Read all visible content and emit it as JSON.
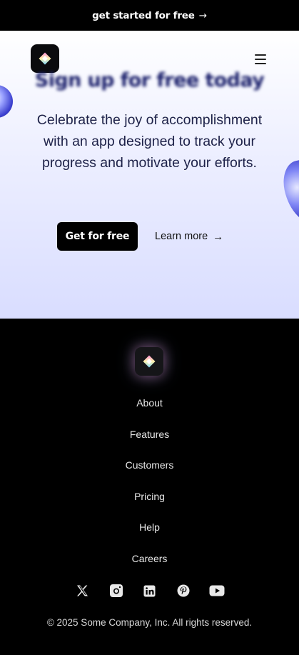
{
  "announcement": {
    "text": "get started for free",
    "arrow": "→"
  },
  "hero": {
    "title": "Sign up for free today",
    "subtitle": "Celebrate the joy of accomplishment with an app designed to track your progress and motivate your efforts.",
    "primary_cta": "Get for free",
    "secondary_cta": "Learn more",
    "secondary_arrow": "→"
  },
  "footer": {
    "links": [
      "About",
      "Features",
      "Customers",
      "Pricing",
      "Help",
      "Careers"
    ],
    "socials": [
      "x-icon",
      "instagram-icon",
      "linkedin-icon",
      "pinterest-icon",
      "youtube-icon"
    ],
    "copyright": "© 2025 Some Company, Inc. All rights reserved."
  },
  "colors": {
    "hero_bg_top": "#ffffff",
    "hero_bg_bottom": "#d9ddff",
    "footer_bg": "#000000",
    "accent": "#3b3fcf"
  }
}
